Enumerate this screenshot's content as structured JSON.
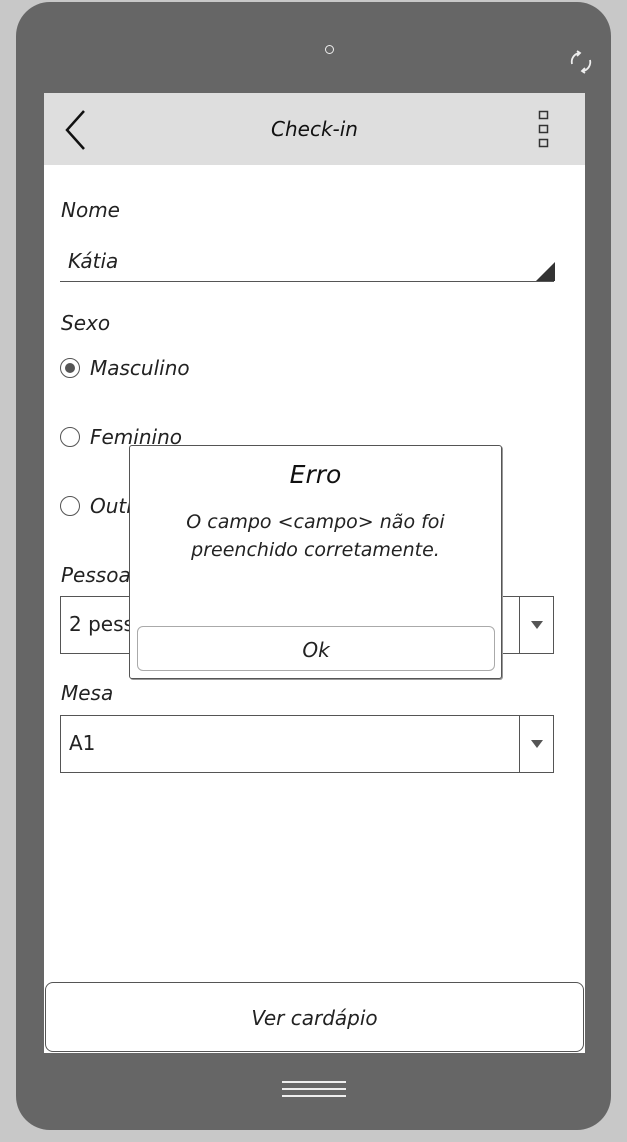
{
  "header": {
    "title": "Check-in",
    "back_icon": "chevron-left-icon",
    "menu_icon": "more-vertical-icon"
  },
  "form": {
    "nome_label": "Nome",
    "nome_value": "Kátia",
    "sexo_label": "Sexo",
    "sexo_options": [
      "Masculino",
      "Feminino",
      "Outro"
    ],
    "sexo_selected": "Masculino",
    "pessoas_label": "Pessoas",
    "pessoas_value": "2 pessoas",
    "mesa_label": "Mesa",
    "mesa_value": "A1"
  },
  "footer": {
    "button_label": "Ver cardápio"
  },
  "dialog": {
    "title": "Erro",
    "message": "O campo <campo> não foi preenchido corretamente.",
    "ok_label": "Ok"
  },
  "colors": {
    "device": "#666666",
    "appbar": "#dedede",
    "background": "#c8c8c8"
  }
}
